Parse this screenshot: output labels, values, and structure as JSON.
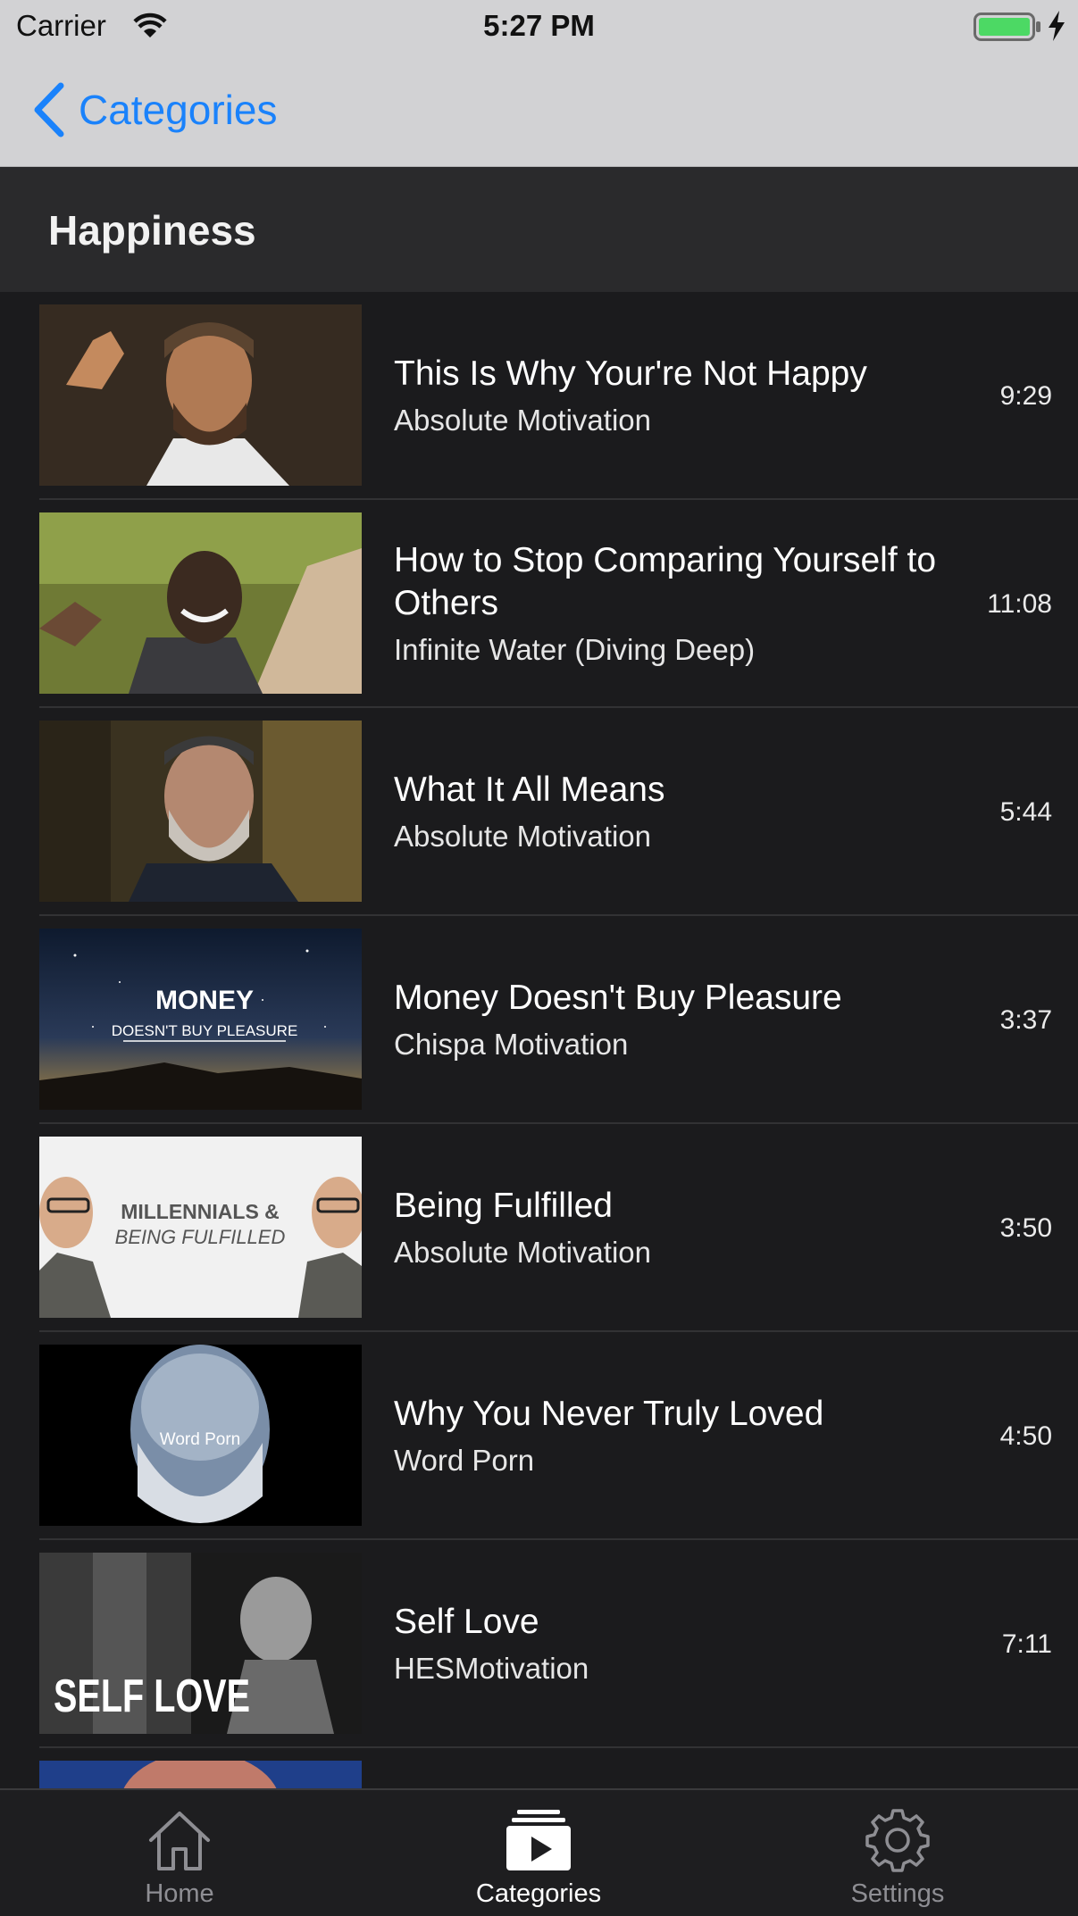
{
  "status_bar": {
    "carrier": "Carrier",
    "time": "5:27 PM",
    "battery_color": "#4cd964"
  },
  "nav": {
    "back_label": "Categories",
    "accent_color": "#1a82fb"
  },
  "section": {
    "title": "Happiness"
  },
  "videos": [
    {
      "title": "This Is Why Your're Not Happy",
      "channel": "Absolute Motivation",
      "duration": "9:29",
      "thumbnail": "bearded-man-portrait"
    },
    {
      "title": "How to Stop Comparing Yourself to Others",
      "channel": "Infinite Water (Diving Deep)",
      "duration": "11:08",
      "thumbnail": "smiling-man-outdoors"
    },
    {
      "title": "What It All Means",
      "channel": "Absolute Motivation",
      "duration": "5:44",
      "thumbnail": "gray-bearded-man"
    },
    {
      "title": "Money Doesn't Buy Pleasure",
      "channel": "Chispa Motivation",
      "duration": "3:37",
      "thumbnail": "night-sky",
      "thumbnail_text": [
        "MONEY",
        "DOESN'T BUY PLEASURE"
      ]
    },
    {
      "title": "Being Fulfilled",
      "channel": "Absolute Motivation",
      "duration": "3:50",
      "thumbnail": "two-men-banner",
      "thumbnail_text": [
        "MILLENNIALS &",
        "BEING FULFILLED"
      ]
    },
    {
      "title": "Why You Never Truly Loved",
      "channel": "Word Porn",
      "duration": "4:50",
      "thumbnail": "bw-portrait",
      "thumbnail_text": [
        "Word Porn"
      ]
    },
    {
      "title": "Self Love",
      "channel": "HESMotivation",
      "duration": "7:11",
      "thumbnail": "bw-child-window",
      "thumbnail_text": [
        "SELF LOVE"
      ]
    },
    {
      "title": "",
      "channel": "",
      "duration": "",
      "thumbnail": "partial-blue"
    }
  ],
  "tab_bar": {
    "tabs": [
      {
        "label": "Home",
        "icon": "house-icon",
        "active": false
      },
      {
        "label": "Categories",
        "icon": "play-stack-icon",
        "active": true
      },
      {
        "label": "Settings",
        "icon": "gear-icon",
        "active": false
      }
    ]
  }
}
